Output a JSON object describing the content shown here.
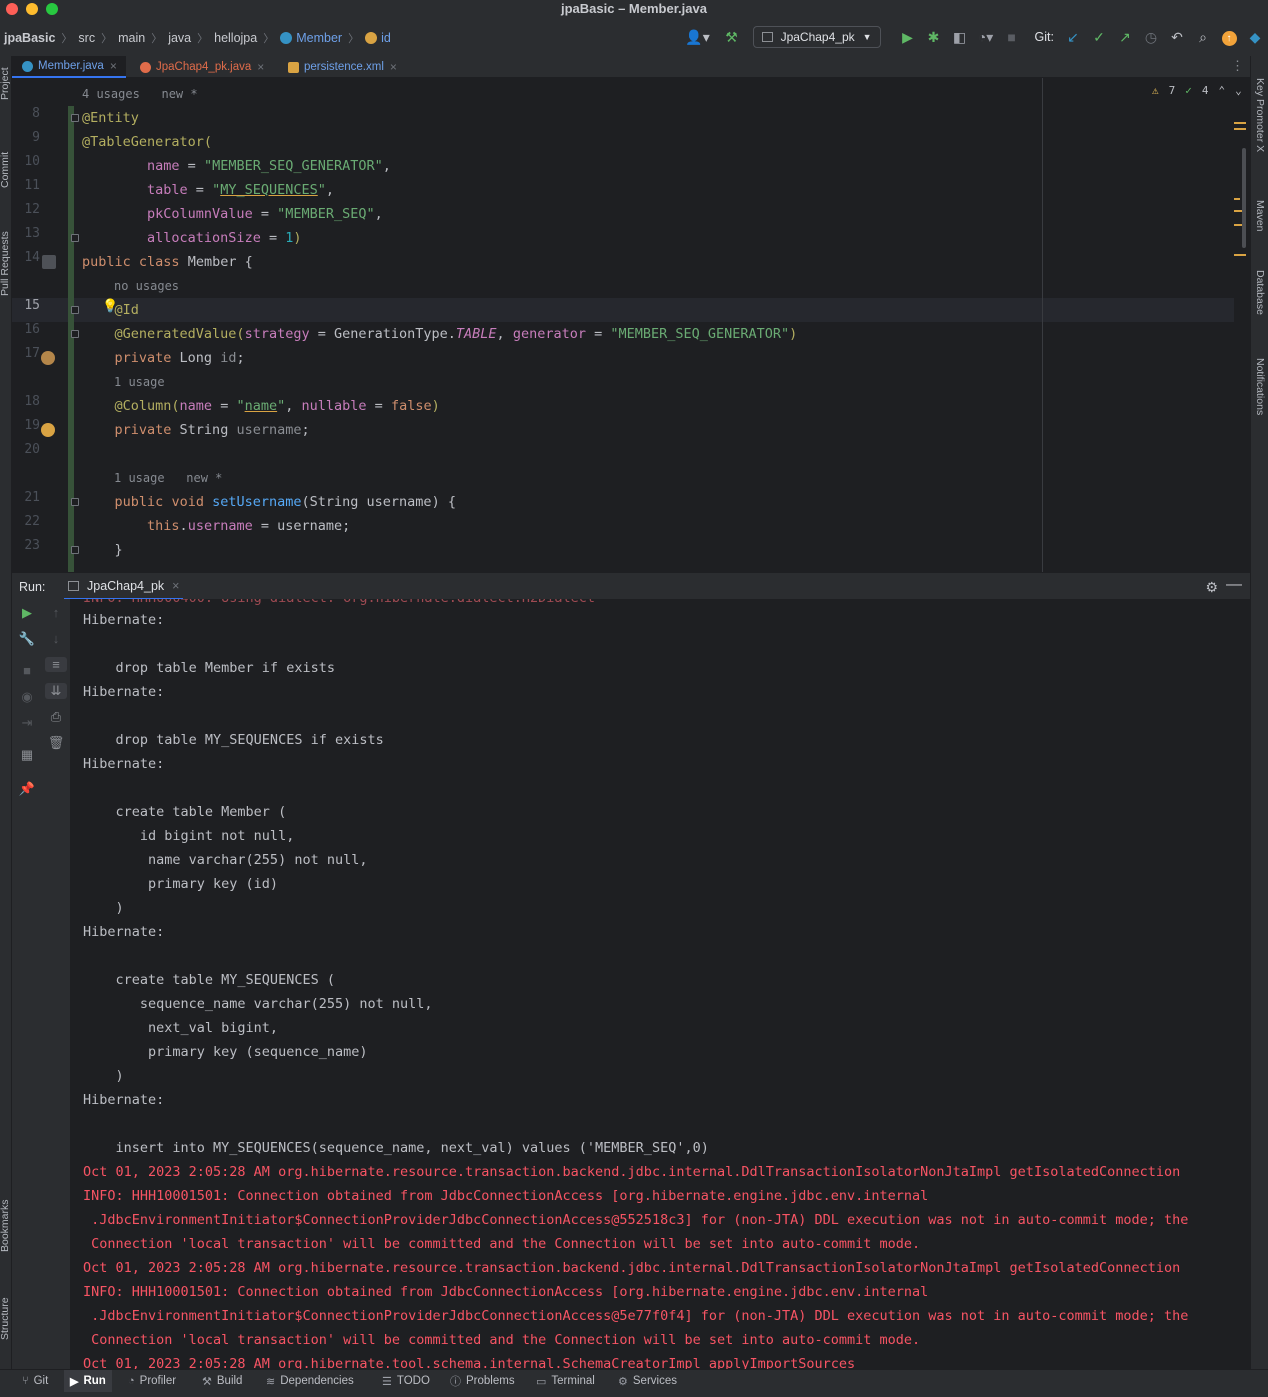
{
  "window": {
    "title": "jpaBasic – Member.java"
  },
  "breadcrumb": [
    "jpaBasic",
    "src",
    "main",
    "java",
    "hellojpa",
    "Member",
    "id"
  ],
  "toolbar": {
    "run_config": "JpaChap4_pk",
    "git_label": "Git:"
  },
  "tabs": [
    {
      "label": "Member.java",
      "active": true,
      "color": "#3592c4"
    },
    {
      "label": "JpaChap4_pk.java",
      "active": false,
      "color": "#e06c4a"
    },
    {
      "label": "persistence.xml",
      "active": false,
      "color": "#d9a343"
    }
  ],
  "left_stripe": [
    "Project",
    "Commit",
    "Pull Requests",
    "Bookmarks",
    "Structure"
  ],
  "right_stripe": [
    "Key Promoter X",
    "Maven",
    "Database",
    "Notifications"
  ],
  "inspections": {
    "warnings": "7",
    "ok": "4"
  },
  "editor": {
    "current_line": "15",
    "hints": {
      "top": "4 usages   new *",
      "id_field": "no usages",
      "username_field": "1 usage",
      "setter": "1 usage   new *"
    },
    "line_numbers": [
      "8",
      "9",
      "10",
      "11",
      "12",
      "13",
      "14",
      "15",
      "16",
      "17",
      "18",
      "19",
      "20",
      "21",
      "22",
      "23"
    ],
    "lines": [
      [
        "@Entity"
      ],
      [
        "@TableGenerator("
      ],
      [
        "        ",
        "name",
        " = ",
        "\"MEMBER_SEQ_GENERATOR\"",
        ","
      ],
      [
        "        ",
        "table",
        " = ",
        "\"",
        "MY_SEQUENCES",
        "\"",
        ","
      ],
      [
        "        ",
        "pkColumnValue",
        " = ",
        "\"MEMBER_SEQ\"",
        ","
      ],
      [
        "        ",
        "allocationSize",
        " = ",
        "1",
        ")"
      ],
      [
        "public",
        " ",
        "class",
        " Member {"
      ],
      [
        "    ",
        "@Id"
      ],
      [
        "    ",
        "@GeneratedValue(",
        "strategy",
        " = GenerationType.",
        "TABLE",
        ", ",
        "generator",
        " = ",
        "\"MEMBER_SEQ_GENERATOR\"",
        ")"
      ],
      [
        "    ",
        "private",
        " Long ",
        "id",
        ";"
      ],
      [
        "    ",
        "@Column(",
        "name",
        " = ",
        "\"",
        "name",
        "\"",
        ", ",
        "nullable",
        " = ",
        "false",
        ")"
      ],
      [
        "    ",
        "private",
        " String ",
        "username",
        ";"
      ],
      [
        ""
      ],
      [
        "    ",
        "public",
        " ",
        "void",
        " ",
        "setUsername",
        "(String ",
        "username",
        ") {"
      ],
      [
        "        ",
        "this",
        ".",
        "username",
        " = ",
        "username",
        ";"
      ],
      [
        "    }"
      ]
    ]
  },
  "run_panel": {
    "label": "Run:",
    "tab": "JpaChap4_pk"
  },
  "console": [
    {
      "t": "Hibernate: ",
      "red": false
    },
    {
      "t": "",
      "red": false
    },
    {
      "t": "    drop table Member if exists",
      "red": false
    },
    {
      "t": "Hibernate: ",
      "red": false
    },
    {
      "t": "",
      "red": false
    },
    {
      "t": "    drop table MY_SEQUENCES if exists",
      "red": false
    },
    {
      "t": "Hibernate: ",
      "red": false
    },
    {
      "t": "",
      "red": false
    },
    {
      "t": "    create table Member (",
      "red": false
    },
    {
      "t": "       id bigint not null,",
      "red": false
    },
    {
      "t": "        name varchar(255) not null,",
      "red": false
    },
    {
      "t": "        primary key (id)",
      "red": false
    },
    {
      "t": "    )",
      "red": false
    },
    {
      "t": "Hibernate: ",
      "red": false
    },
    {
      "t": "",
      "red": false
    },
    {
      "t": "    create table MY_SEQUENCES (",
      "red": false
    },
    {
      "t": "       sequence_name varchar(255) not null,",
      "red": false
    },
    {
      "t": "        next_val bigint,",
      "red": false
    },
    {
      "t": "        primary key (sequence_name)",
      "red": false
    },
    {
      "t": "    )",
      "red": false
    },
    {
      "t": "Hibernate: ",
      "red": false
    },
    {
      "t": "",
      "red": false
    },
    {
      "t": "    insert into MY_SEQUENCES(sequence_name, next_val) values ('MEMBER_SEQ',0)",
      "red": false
    },
    {
      "t": "Oct 01, 2023 2:05:28 AM org.hibernate.resource.transaction.backend.jdbc.internal.DdlTransactionIsolatorNonJtaImpl getIsolatedConnection",
      "red": true
    },
    {
      "t": "INFO: HHH10001501: Connection obtained from JdbcConnectionAccess [org.hibernate.engine.jdbc.env.internal",
      "red": true
    },
    {
      "t": " .JdbcEnvironmentInitiator$ConnectionProviderJdbcConnectionAccess@552518c3] for (non-JTA) DDL execution was not in auto-commit mode; the",
      "red": true
    },
    {
      "t": " Connection 'local transaction' will be committed and the Connection will be set into auto-commit mode.",
      "red": true
    },
    {
      "t": "Oct 01, 2023 2:05:28 AM org.hibernate.resource.transaction.backend.jdbc.internal.DdlTransactionIsolatorNonJtaImpl getIsolatedConnection",
      "red": true
    },
    {
      "t": "INFO: HHH10001501: Connection obtained from JdbcConnectionAccess [org.hibernate.engine.jdbc.env.internal",
      "red": true
    },
    {
      "t": " .JdbcEnvironmentInitiator$ConnectionProviderJdbcConnectionAccess@5e77f0f4] for (non-JTA) DDL execution was not in auto-commit mode; the",
      "red": true
    },
    {
      "t": " Connection 'local transaction' will be committed and the Connection will be set into auto-commit mode.",
      "red": true
    },
    {
      "t": "Oct 01, 2023 2:05:28 AM org.hibernate.tool.schema.internal.SchemaCreatorImpl applyImportSources",
      "red": true
    }
  ],
  "status_tools": [
    {
      "label": "Git",
      "icon": "git-icon"
    },
    {
      "label": "Run",
      "icon": "run-icon",
      "active": true
    },
    {
      "label": "Profiler",
      "icon": "profiler-icon"
    },
    {
      "label": "Build",
      "icon": "hammer-icon"
    },
    {
      "label": "Dependencies",
      "icon": "layers-icon"
    },
    {
      "label": "TODO",
      "icon": "list-icon"
    },
    {
      "label": "Problems",
      "icon": "info-icon"
    },
    {
      "label": "Terminal",
      "icon": "terminal-icon"
    },
    {
      "label": "Services",
      "icon": "services-icon"
    }
  ],
  "colors": {
    "accent": "#3574f0",
    "error_text": "#f75464",
    "annotation": "#b3ae60",
    "keyword": "#cf8e6d",
    "string": "#6aab73"
  }
}
